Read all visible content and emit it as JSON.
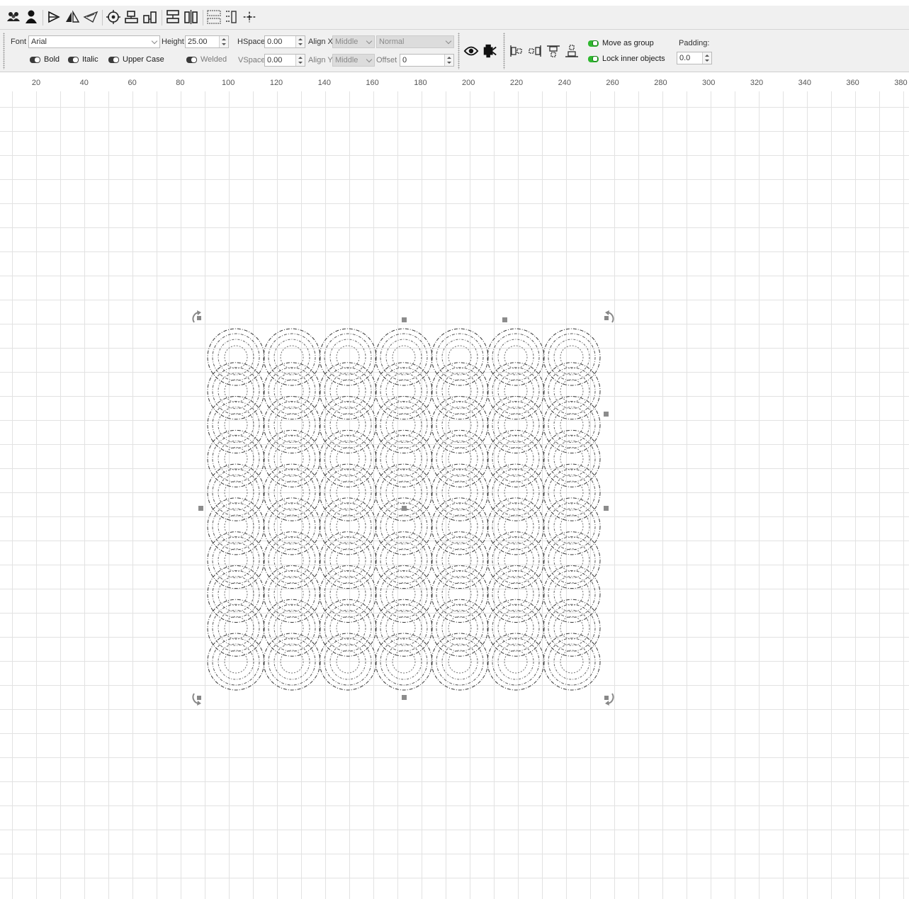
{
  "toolbar_top": {
    "icons": [
      "group-icon",
      "ungroup-icon",
      "flip-horizontal-icon",
      "mirror-icon",
      "shear-icon",
      "center-icon",
      "align-left-icon",
      "align-right-icon",
      "distribute-vertical-icon",
      "distribute-horizontal-icon",
      "dock-icon",
      "move-icon"
    ]
  },
  "text_options": {
    "font_label": "Font",
    "font_value": "Arial",
    "height_label": "Height",
    "height_value": "25.00",
    "hspace_label": "HSpace",
    "hspace_value": "0.00",
    "vspace_label": "VSpace",
    "vspace_value": "0.00",
    "alignx_label": "Align X",
    "alignx_value": "Middle",
    "aligny_label": "Align Y",
    "aligny_value": "Middle",
    "style_value": "Normal",
    "offset_label": "Offset",
    "offset_value": "0",
    "bold_label": "Bold",
    "italic_label": "Italic",
    "uppercase_label": "Upper Case",
    "welded_label": "Welded"
  },
  "group_options": {
    "move_as_group_label": "Move as group",
    "lock_inner_label": "Lock inner objects",
    "padding_label": "Padding:",
    "padding_value": "0.0",
    "move_as_group_on": true,
    "lock_inner_on": true
  },
  "ruler": {
    "ticks": [
      "20",
      "40",
      "60",
      "80",
      "100",
      "120",
      "140",
      "160",
      "180",
      "200",
      "220",
      "240",
      "260",
      "280",
      "300",
      "320",
      "340",
      "360",
      "380"
    ]
  },
  "colors": {
    "accent_green": "#2fb82f",
    "grid_line": "#e2e2e2",
    "handle": "#8c8c8c",
    "stroke": "#222222"
  }
}
